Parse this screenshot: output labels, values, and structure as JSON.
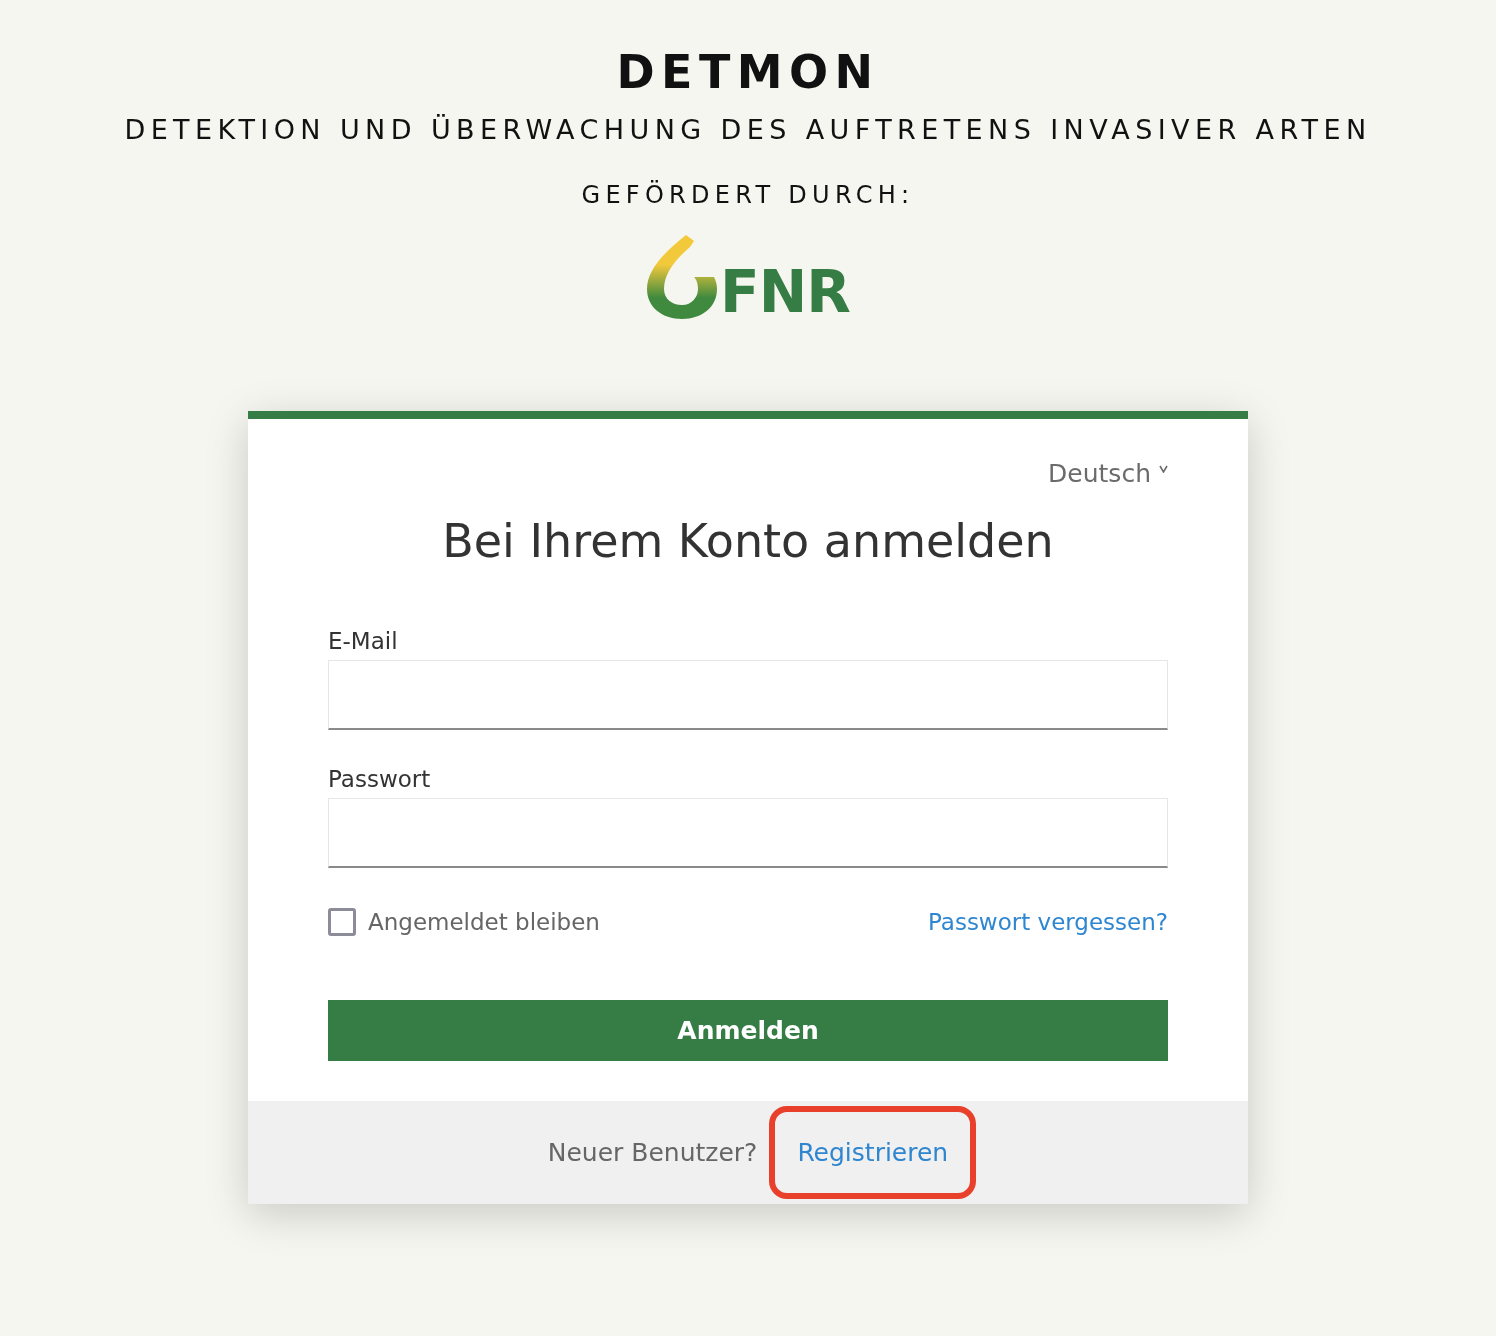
{
  "header": {
    "title": "DETMON",
    "subtitle": "DETEKTION UND ÜBERWACHUNG DES AUFTRETENS INVASIVER ARTEN",
    "funded_by": "GEFÖRDERT DURCH:",
    "logo_text": "FNR"
  },
  "login": {
    "language": "Deutsch",
    "heading": "Bei Ihrem Konto anmelden",
    "fields": [
      {
        "label": "E-Mail"
      },
      {
        "label": "Passwort"
      }
    ],
    "remember": {
      "label": "Angemeldet bleiben",
      "checked": false
    },
    "forgot_link": "Passwort vergessen?",
    "submit": "Anmelden",
    "footer": {
      "prompt": "Neuer Benutzer?",
      "link": "Registrieren",
      "highlighted": true
    }
  }
}
